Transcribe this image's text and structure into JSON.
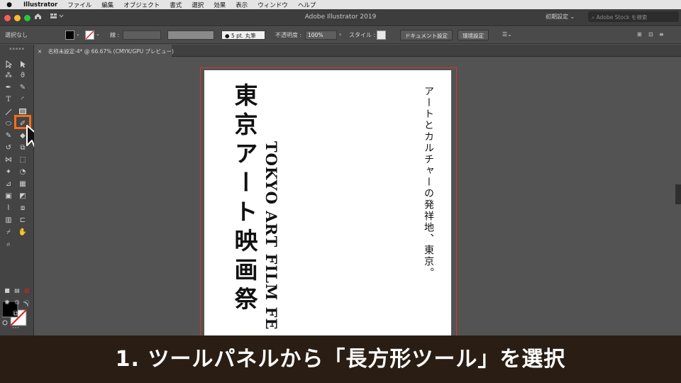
{
  "menubar": {
    "app": "Illustrator",
    "items": [
      "ファイル",
      "編集",
      "オブジェクト",
      "書式",
      "選択",
      "効果",
      "表示",
      "ウィンドウ",
      "ヘルプ"
    ]
  },
  "titlebar": {
    "title": "Adobe Illustrator 2019",
    "workspace": "初期設定",
    "workspace_chevron": "⌄",
    "search_placeholder": "Adobe Stock を検索"
  },
  "control": {
    "selection": "選択なし",
    "stroke_label": "線 :",
    "brush": "5 pt. 丸筆",
    "opacity_label": "不透明度 :",
    "opacity_value": "100%",
    "style_label": "スタイル :",
    "doc_settings": "ドキュメント設定",
    "prefs": "環境設定"
  },
  "tab": {
    "close": "×",
    "label": "名称未設定-4* @ 66.67% (CMYK/GPU プレビュー)"
  },
  "artboard": {
    "title": "東京アート映画祭",
    "english": "TOKYO ART FILM FE",
    "subtitle": "アートとカルチャーの発祥地、東京。"
  },
  "caption": "1. ツールパネルから「長方形ツール」を選択",
  "colors": {
    "accent": "#f26f1a",
    "artboard_border": "#d43a2a",
    "caption_bg": "#2a1e14"
  },
  "icons": {
    "tool_highlight": "rectangle-tool-icon",
    "cursor": "arrow-cursor-icon"
  }
}
